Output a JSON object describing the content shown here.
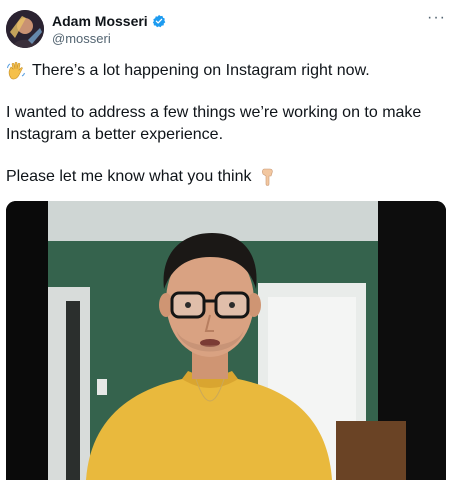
{
  "author": {
    "display_name": "Adam Mosseri",
    "handle": "@mosseri",
    "verified": true,
    "avatar_icon": "profile-photo"
  },
  "menu": {
    "more_label": "···",
    "more_icon": "more-options-icon"
  },
  "tweet": {
    "line1": "There’s a lot happening on Instagram right now.",
    "line1_emoji": "waving-hand-emoji",
    "paragraph2": "I wanted to address a few things we’re working on to make Instagram a better experience.",
    "line3": "Please let me know what you think",
    "line3_emoji": "pointing-down-emoji"
  },
  "media": {
    "type": "video-thumbnail",
    "description_icon": "video-frame"
  },
  "colors": {
    "verified_badge": "#1d9bf0",
    "text_primary": "#0f1419",
    "text_secondary": "#536471",
    "wall_green": "#35634d",
    "sweater_yellow": "#e9b93d"
  }
}
